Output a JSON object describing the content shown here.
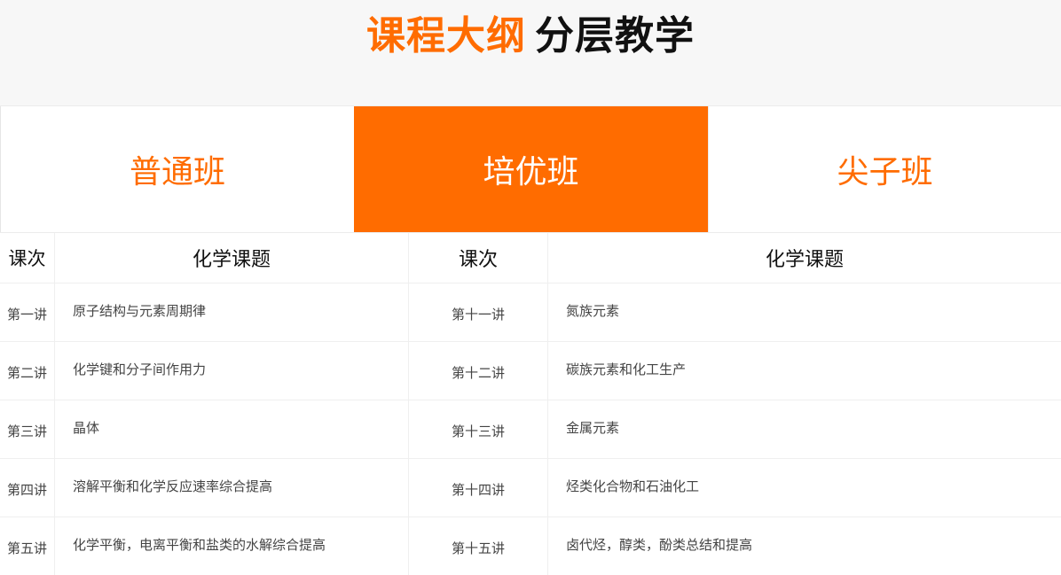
{
  "header": {
    "title_accent": "课程大纲",
    "title_plain": "分层教学"
  },
  "tabs": [
    {
      "label": "普通班",
      "active": false
    },
    {
      "label": "培优班",
      "active": true
    },
    {
      "label": "尖子班",
      "active": false
    }
  ],
  "table": {
    "headers": [
      "课次",
      "化学课题",
      "课次",
      "化学课题"
    ],
    "rows": [
      {
        "lesson_a": "第一讲",
        "topic_a": "原子结构与元素周期律",
        "lesson_b": "第十一讲",
        "topic_b": "氮族元素"
      },
      {
        "lesson_a": "第二讲",
        "topic_a": "化学键和分子间作用力",
        "lesson_b": "第十二讲",
        "topic_b": "碳族元素和化工生产"
      },
      {
        "lesson_a": "第三讲",
        "topic_a": "晶体",
        "lesson_b": "第十三讲",
        "topic_b": "金属元素"
      },
      {
        "lesson_a": "第四讲",
        "topic_a": "溶解平衡和化学反应速率综合提高",
        "lesson_b": "第十四讲",
        "topic_b": "烃类化合物和石油化工"
      },
      {
        "lesson_a": "第五讲",
        "topic_a": "化学平衡，电离平衡和盐类的水解综合提高",
        "lesson_b": "第十五讲",
        "topic_b": "卤代烃，醇类，酚类总结和提高"
      }
    ]
  },
  "colors": {
    "accent": "#ff6c00",
    "header_bg": "#f7f7f7",
    "title_dark": "#111111"
  }
}
